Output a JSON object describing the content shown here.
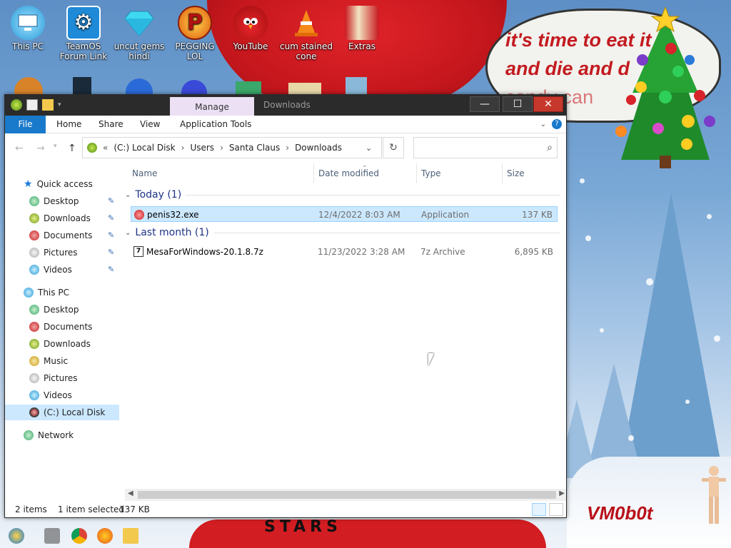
{
  "desktop": {
    "icons": [
      {
        "label": "This PC",
        "icon": "this-pc-icon"
      },
      {
        "label": "TeamOS Forum Link",
        "icon": "gear-icon"
      },
      {
        "label": "uncut gems hindi",
        "icon": "diamond-icon"
      },
      {
        "label": "PEGGING LOL",
        "icon": "p-logo-icon"
      },
      {
        "label": "YouTube",
        "icon": "angry-bird-icon"
      },
      {
        "label": "cum stained cone",
        "icon": "traffic-cone-icon"
      },
      {
        "label": "Extras",
        "icon": "folder-red-icon"
      }
    ],
    "speech_text_line1": "it's time to eat it",
    "speech_text_line2": "and die and d",
    "speech_text_line3": "candy can",
    "bottom_text": "STARS",
    "watermark": "VM0b0t"
  },
  "window": {
    "title": "Downloads",
    "manage_tab": "Manage",
    "ribbon": {
      "file": "File",
      "home": "Home",
      "share": "Share",
      "view": "View",
      "app_tools": "Application Tools"
    },
    "address": {
      "overflow": "«",
      "crumbs": [
        "(C:) Local Disk",
        "Users",
        "Santa Claus",
        "Downloads"
      ],
      "search_placeholder": ""
    },
    "nav": {
      "quick_access": "Quick access",
      "quick_items": [
        "Desktop",
        "Downloads",
        "Documents",
        "Pictures",
        "Videos"
      ],
      "this_pc": "This PC",
      "pc_items": [
        "Desktop",
        "Documents",
        "Downloads",
        "Music",
        "Pictures",
        "Videos",
        "(C:) Local Disk"
      ],
      "network": "Network"
    },
    "columns": {
      "name": "Name",
      "date": "Date modified",
      "type": "Type",
      "size": "Size"
    },
    "groups": [
      {
        "label": "Today (1)",
        "files": [
          {
            "name": "penis32.exe",
            "date": "12/4/2022 8:03 AM",
            "type": "Application",
            "size": "137 KB",
            "selected": true
          }
        ]
      },
      {
        "label": "Last month (1)",
        "files": [
          {
            "name": "MesaForWindows-20.1.8.7z",
            "date": "11/23/2022 3:28 AM",
            "type": "7z Archive",
            "size": "6,895 KB",
            "selected": false
          }
        ]
      }
    ],
    "status": {
      "items": "2 items",
      "selected": "1 item selected",
      "size": "137 KB"
    }
  },
  "colors": {
    "accent": "#1979ca",
    "selection": "#cce8ff",
    "close_button": "#c7382c",
    "manage_tab": "#ece0f4"
  }
}
